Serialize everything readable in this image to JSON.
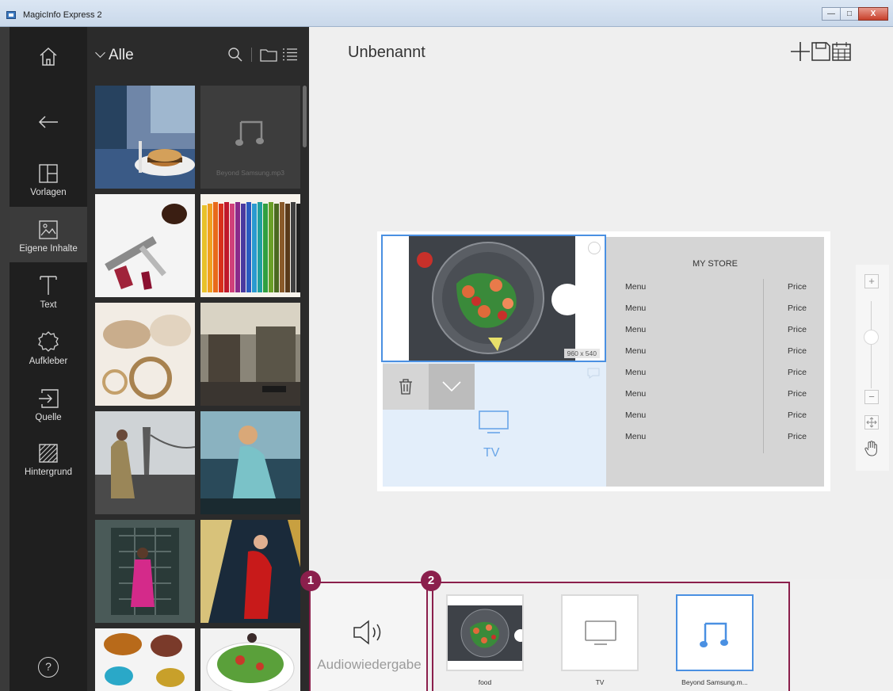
{
  "window": {
    "title": "MagicInfo Express 2",
    "buttons": {
      "minimize": "—",
      "maximize": "□",
      "close": "X"
    }
  },
  "nav": {
    "items": [
      {
        "label": "",
        "icon": "home-icon"
      },
      {
        "label": "",
        "icon": "back-arrow-icon"
      },
      {
        "label": "Vorlagen",
        "icon": "templates-icon"
      },
      {
        "label": "Eigene Inhalte",
        "icon": "my-content-icon",
        "active": true
      },
      {
        "label": "Text",
        "icon": "text-icon"
      },
      {
        "label": "Aufkleber",
        "icon": "sticker-icon"
      },
      {
        "label": "Quelle",
        "icon": "source-icon"
      },
      {
        "label": "Hintergrund",
        "icon": "background-icon"
      }
    ],
    "help_label": "?"
  },
  "media": {
    "filter_label": "Alle",
    "audio_file": "Beyond Samsung.mp3"
  },
  "editor": {
    "doc_title": "Unbenannt",
    "size_badge": "960 x 540",
    "tv_label": "TV",
    "store_title": "MY STORE",
    "menu": [
      {
        "item": "Menu",
        "price": "Price"
      },
      {
        "item": "Menu",
        "price": "Price"
      },
      {
        "item": "Menu",
        "price": "Price"
      },
      {
        "item": "Menu",
        "price": "Price"
      },
      {
        "item": "Menu",
        "price": "Price"
      },
      {
        "item": "Menu",
        "price": "Price"
      },
      {
        "item": "Menu",
        "price": "Price"
      },
      {
        "item": "Menu",
        "price": "Price"
      }
    ],
    "zoom_level": 0.7
  },
  "bottom": {
    "marker1": "1",
    "marker2": "2",
    "audio_label": "Audiowiedergabe",
    "playlist": [
      {
        "label": "food"
      },
      {
        "label": "TV"
      },
      {
        "label": "Beyond Samsung.m..."
      }
    ]
  },
  "colors": {
    "accent": "#4a90e2",
    "marker": "#8b1f4c",
    "nav_bg": "#1f1f1f",
    "panel_bg": "#2b2b2b"
  }
}
